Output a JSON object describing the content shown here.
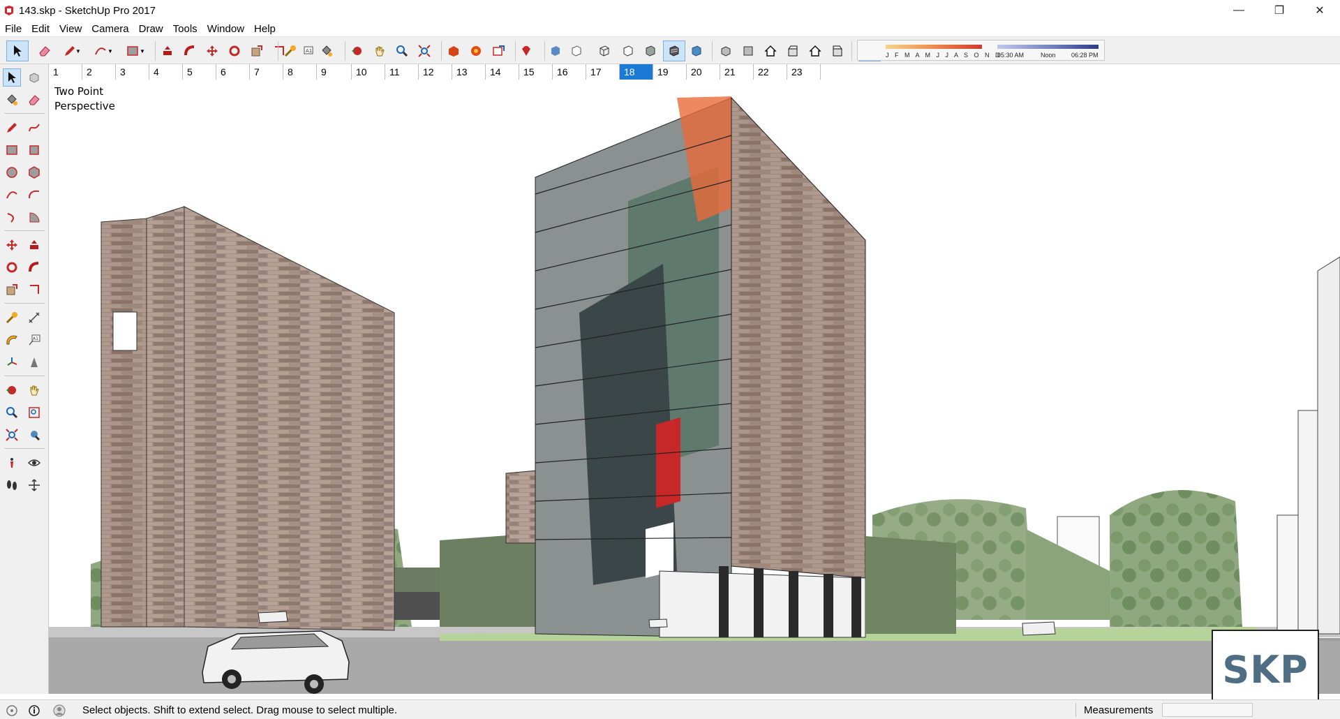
{
  "window": {
    "title": "143.skp - SketchUp Pro 2017",
    "minimize_glyph": "—",
    "maximize_glyph": "❐",
    "close_glyph": "✕"
  },
  "menu": [
    "File",
    "Edit",
    "View",
    "Camera",
    "Draw",
    "Tools",
    "Window",
    "Help"
  ],
  "shadows": {
    "months": "J F M A M J J A S O N D",
    "time_start": "05:30 AM",
    "time_mid": "Noon",
    "time_end": "06:28 PM"
  },
  "scenes": {
    "tabs": [
      "1",
      "2",
      "3",
      "4",
      "5",
      "6",
      "7",
      "8",
      "9",
      "10",
      "11",
      "12",
      "13",
      "14",
      "15",
      "16",
      "17",
      "18",
      "19",
      "20",
      "21",
      "22",
      "23"
    ],
    "active": "18"
  },
  "viewport": {
    "camera_label_line1": "Two Point",
    "camera_label_line2": "Perspective"
  },
  "watermark": {
    "text": "SKP"
  },
  "status": {
    "message": "Select objects. Shift to extend select. Drag mouse to select multiple.",
    "measurements_label": "Measurements",
    "measurements_value": ""
  },
  "colors": {
    "accent": "#1a7ad4",
    "sky": "#ffffff",
    "ground": "#9a9a9a",
    "brick": "#a48d82",
    "trees": "#7d9a6a"
  }
}
